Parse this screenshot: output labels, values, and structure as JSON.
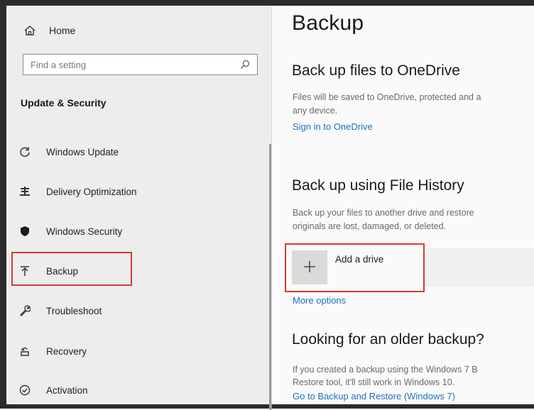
{
  "sidebar": {
    "home_label": "Home",
    "search_placeholder": "Find a setting",
    "section_title": "Update & Security",
    "items": [
      {
        "label": "Windows Update",
        "icon": "sync-icon"
      },
      {
        "label": "Delivery Optimization",
        "icon": "delivery-optimization-icon"
      },
      {
        "label": "Windows Security",
        "icon": "shield-icon"
      },
      {
        "label": "Backup",
        "icon": "backup-arrow-icon"
      },
      {
        "label": "Troubleshoot",
        "icon": "wrench-icon"
      },
      {
        "label": "Recovery",
        "icon": "recovery-icon"
      },
      {
        "label": "Activation",
        "icon": "activation-check-icon"
      }
    ]
  },
  "main": {
    "title": "Backup",
    "onedrive": {
      "heading": "Back up files to OneDrive",
      "desc_line1": "Files will be saved to OneDrive, protected and a",
      "desc_line2": "any device.",
      "link": "Sign in to OneDrive"
    },
    "file_history": {
      "heading": "Back up using File History",
      "desc_line1": "Back up your files to another drive and restore",
      "desc_line2": "originals are lost, damaged, or deleted.",
      "add_drive_label": "Add a drive",
      "more_options": "More options"
    },
    "older_backup": {
      "heading": "Looking for an older backup?",
      "desc_line1": "If you created a backup using the Windows 7 B",
      "desc_line2": "Restore tool, it'll still work in Windows 10.",
      "link": "Go to Backup and Restore (Windows 7)"
    }
  },
  "colors": {
    "highlight": "#d83b2c",
    "link": "#1f6fc0",
    "sidebar_bg": "#ededed"
  }
}
